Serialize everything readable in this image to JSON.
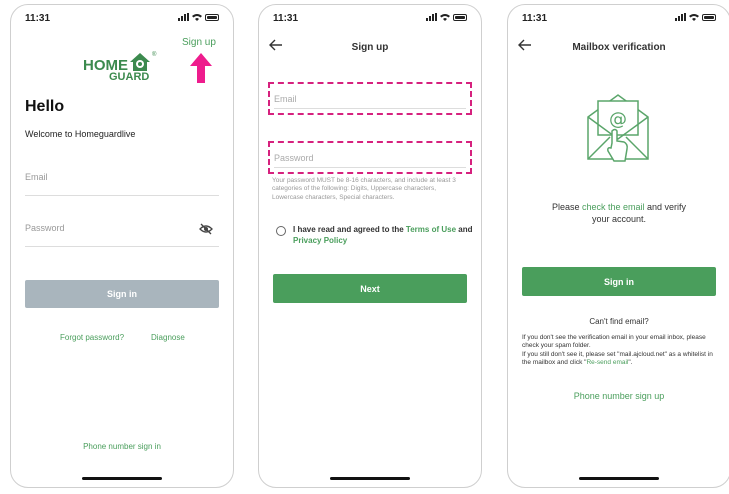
{
  "status": {
    "time": "11:31"
  },
  "screen1": {
    "logo_top": "HOME",
    "logo_bottom": "GUARD",
    "logo_mark": "®",
    "signup_link": "Sign up",
    "greeting": "Hello",
    "welcome": "Welcome to Homeguardlive",
    "email_placeholder": "Email",
    "password_placeholder": "Password",
    "signin_button": "Sign in",
    "forgot_link": "Forgot password?",
    "diagnose_link": "Diagnose",
    "phone_signin_link": "Phone number sign in"
  },
  "screen2": {
    "title": "Sign up",
    "email_placeholder": "Email",
    "password_placeholder": "Password",
    "password_hint": "Your password MUST be 8-16 characters, and include at least 3 categories of the following: Digits, Uppercase characters, Lowercase characters, Special characters.",
    "agree_prefix": "I have read and agreed to the ",
    "terms_link": "Terms of Use",
    "agree_and": " and",
    "privacy_link": "Privacy Policy",
    "next_button": "Next"
  },
  "screen3": {
    "title": "Mailbox verification",
    "msg_prefix": "Please ",
    "msg_link": "check the email",
    "msg_suffix": " and verify",
    "msg_line2": "your account.",
    "signin_button": "Sign in",
    "cant_find": "Can't find email?",
    "help1": "If you don't see the verification email in your email inbox, please check your spam folder.",
    "help2_prefix": "If you still don't see it, please set \"mail.ajcloud.net\" as a whitelist in the mailbox and click \"",
    "help2_link": "Re-send email",
    "help2_suffix": "\".",
    "phone_signup_link": "Phone number sign up"
  },
  "colors": {
    "accent": "#4a9e5c",
    "disabled": "#a9b5bd",
    "highlight": "#d6217e",
    "arrow": "#ee1c8d"
  },
  "icons": [
    "signal-icon",
    "wifi-icon",
    "battery-icon",
    "eye-off-icon",
    "back-arrow-icon",
    "mail-icon",
    "pointer-hand-icon",
    "up-arrow-icon"
  ]
}
